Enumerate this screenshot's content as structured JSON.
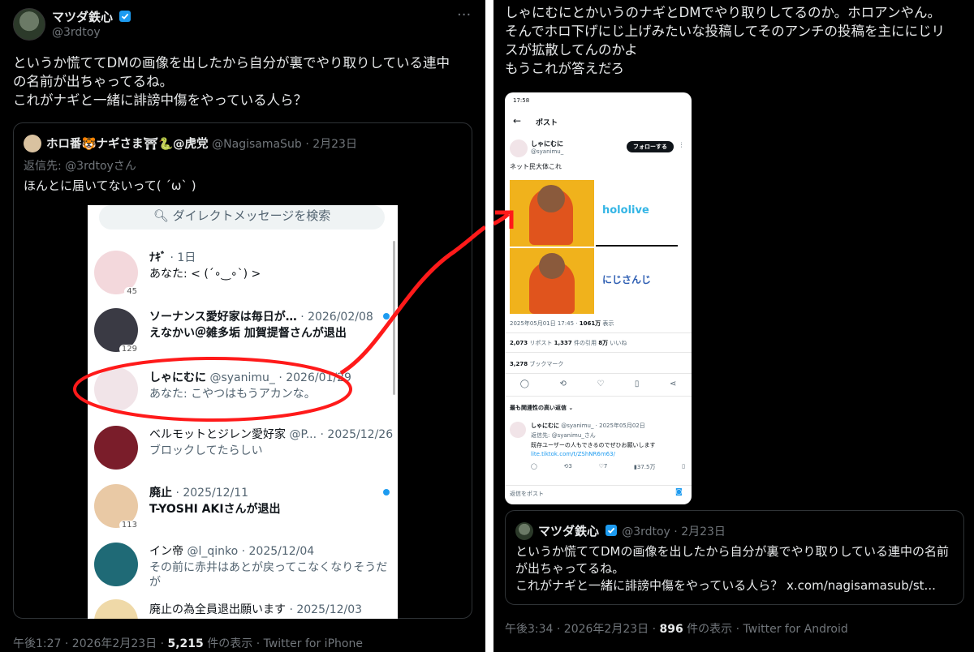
{
  "left_tweet": {
    "author_name": "マツダ鉄心",
    "author_handle": "@3rdtoy",
    "more_icon": "more-horizontal-icon",
    "text_lines": [
      "というか慌ててDMの画像を出したから自分が裏でやり取りしている連中",
      "の名前が出ちゃってるね。",
      "これがナギと一緒に誹謗中傷をやっている人ら？"
    ],
    "quote": {
      "author_name": "ホロ番🐯ナギさま⛩🐍@虎党",
      "author_handle": "@NagisamaSub",
      "date": "· 2月23日",
      "reply_to": "返信先: @3rdtoyさん",
      "text": "ほんとに届いてないって(  ´ω` )",
      "dm": {
        "search_placeholder": "ダイレクトメッセージを検索",
        "rows": [
          {
            "name": "ﾅｷﾞ",
            "meta": "· 1日",
            "msg": "あなた: < (´∘‿∘`) >",
            "badge": "45",
            "color": "#f3d8dc",
            "unread": false
          },
          {
            "name": "ソーナンス愛好家は毎日が…",
            "meta": "· 2026/02/08",
            "msg": "えなかい＠雑多垢 加賀提督さんが退出",
            "badge": "129",
            "color": "#3a3a44",
            "unread": true
          },
          {
            "name": "しゃにむに",
            "handle": "@syanimu_",
            "meta": "· 2026/01/29",
            "msg": "あなた: こやつはもうアカンな。",
            "badge": "",
            "color": "#f1e4e8",
            "unread": false
          },
          {
            "name": "ベルモットとジレン愛好家",
            "handle": "@P...",
            "meta": "· 2025/12/26",
            "msg": "ブロックしてたらしい",
            "badge": "",
            "color": "#7a1d2a",
            "unread": false
          },
          {
            "name": "廃止",
            "meta": "· 2025/12/11",
            "msg": "T-YOSHI AKIさんが退出",
            "badge": "113",
            "color": "#e9c9a5",
            "unread": true
          },
          {
            "name": "イン帝",
            "handle": "@l_qinko",
            "meta": "· 2025/12/04",
            "msg": "その前に赤井はあとが戻ってこなくなりそうだ",
            "msg2": "が",
            "badge": "",
            "color": "#1f6a76",
            "unread": false
          },
          {
            "name": "廃止の為全員退出願います",
            "meta": "· 2025/12/03",
            "msg": "",
            "badge": "",
            "color": "#efd9a8",
            "unread": false
          }
        ]
      }
    },
    "footer": {
      "time": "午後1:27 · 2026年2月23日 · ",
      "views": "5,215",
      "views_suffix": " 件の表示 · ",
      "client": "Twitter for iPhone"
    }
  },
  "right_tweet": {
    "text_lines": [
      "しゃにむにとかいうのナギとDMでやり取りしてるのか。ホロアンやん。",
      "そんでホロ下げにじ上げみたいな投稿してそのアンチの投稿を主ににじリ",
      "スが拡散してんのかよ",
      "もうこれが答えだろ"
    ],
    "phone": {
      "status_time": "17:58",
      "header_title": "ポスト",
      "author_name": "しゃにむに",
      "author_handle": "@syanimu_",
      "follow_label": "フォローする",
      "post_text": "ネット民大体これ",
      "meme_top_logo": "hololive",
      "meme_bottom_logo": "にじさんじ",
      "post_meta": "2025年05月01日 17:45 · ",
      "post_views": "1061万",
      "post_views_suffix": " 表示",
      "reposts": "2,073",
      "reposts_label": " リポスト  ",
      "quotes": "1,337",
      "quotes_label": " 件の引用  ",
      "likes": "8万",
      "likes_label": " いいね",
      "bookmarks": "3,278",
      "bookmarks_label": " ブックマーク",
      "relevance": "最も関連性の高い返信 ⌄",
      "reply_name": "しゃにむに",
      "reply_handle": "@syanimu_ · 2025年05月02日",
      "reply_to": "返信先: @syanimu_さん",
      "reply_text": "既存ユーザーの人もできるのでぜひお願いします",
      "reply_link": "lite.tiktok.com/t/ZShNR6m63/",
      "reply_stats": [
        "",
        "3",
        "7",
        "37.5万"
      ],
      "reply_input": "返信をポスト"
    },
    "quote": {
      "author_name": "マツダ鉄心",
      "author_handle": "@3rdtoy · 2月23日",
      "text_lines": [
        "というか慌ててDMの画像を出したから自分が裏でやり取りしている連中の名前",
        "が出ちゃってるね。",
        "これがナギと一緒に誹謗中傷をやっている人ら？ x.com/nagisamasub/st..."
      ]
    },
    "footer": {
      "time": "午後3:34 · 2026年2月23日 · ",
      "views": "896",
      "views_suffix": " 件の表示 · ",
      "client": "Twitter for Android"
    }
  },
  "colors": {
    "accent": "#1d9bf0",
    "highlight": "#ff1a1a",
    "bg": "#000000"
  }
}
